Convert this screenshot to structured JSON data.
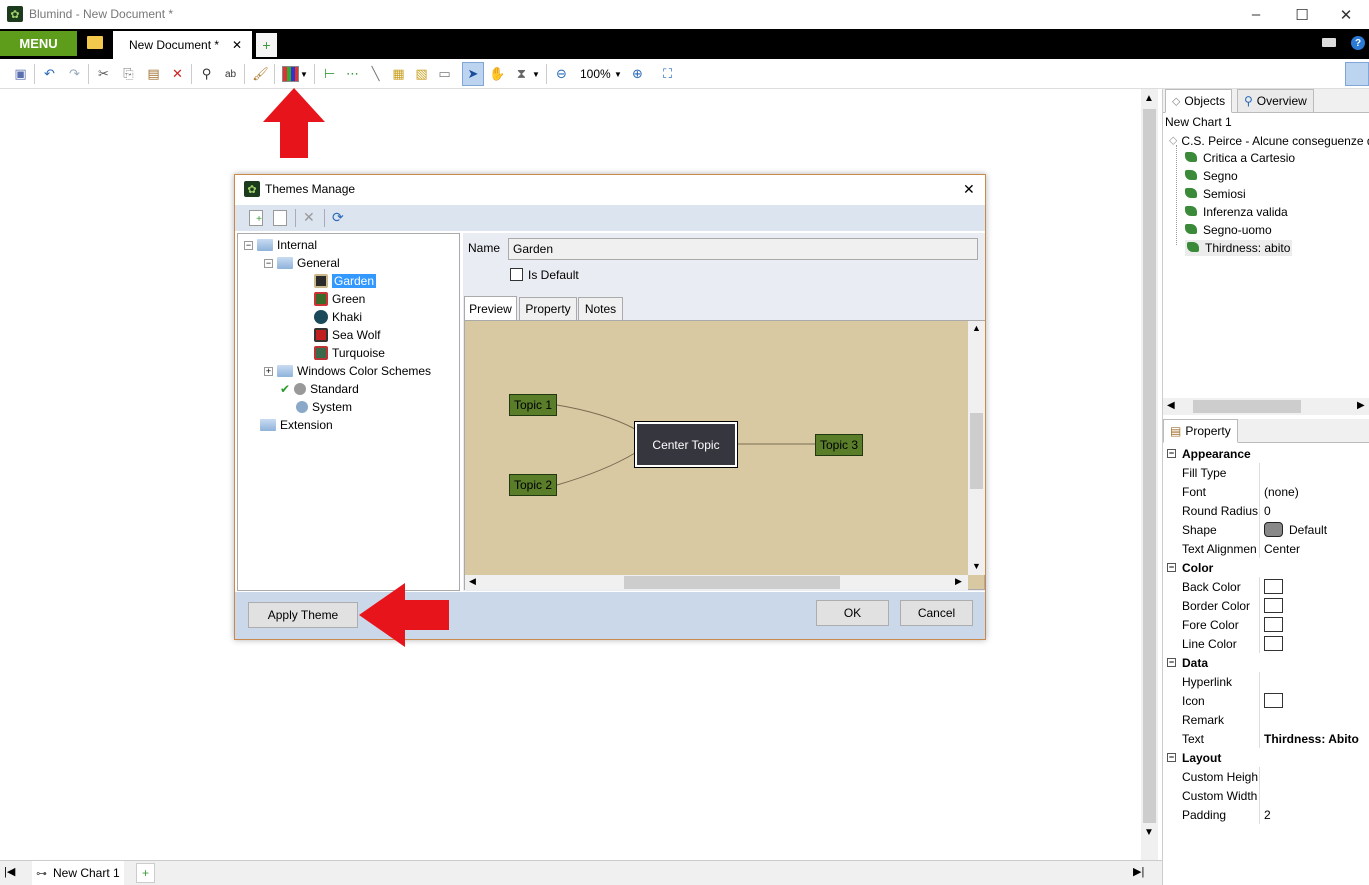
{
  "window": {
    "title": "Blumind - New Document *"
  },
  "tabbar": {
    "menu_label": "MENU",
    "doc_tab": "New Document *"
  },
  "toolbar": {
    "zoom": "100%"
  },
  "right_panel": {
    "tabs": [
      "Objects",
      "Overview"
    ],
    "chart_name": "New Chart 1",
    "root_topic": "C.S. Peirce - Alcune conseguenze d",
    "children": [
      "Critica a Cartesio",
      "Segno",
      "Semiosi",
      "Inferenza valida",
      "Segno-uomo",
      "Thirdness: abito"
    ],
    "property_tab": "Property",
    "sections": {
      "appearance": "Appearance",
      "color": "Color",
      "data": "Data",
      "layout": "Layout"
    },
    "props": {
      "fill_type": "Fill Type",
      "font": "Font",
      "font_val": "(none)",
      "round_radius": "Round Radius",
      "round_radius_val": "0",
      "shape": "Shape",
      "shape_val": "Default",
      "text_align": "Text Alignmen",
      "text_align_val": "Center",
      "back_color": "Back Color",
      "border_color": "Border Color",
      "fore_color": "Fore Color",
      "line_color": "Line Color",
      "hyperlink": "Hyperlink",
      "icon": "Icon",
      "remark": "Remark",
      "text": "Text",
      "text_val": "Thirdness: Abito",
      "custom_height": "Custom Heigh",
      "custom_width": "Custom Width",
      "padding": "Padding",
      "padding_val": "2"
    }
  },
  "bottom": {
    "chart_tab": "New Chart 1"
  },
  "dialog": {
    "title": "Themes Manage",
    "tree": {
      "internal": "Internal",
      "general": "General",
      "themes": [
        "Garden",
        "Green",
        "Khaki",
        "Sea Wolf",
        "Turquoise"
      ],
      "windows_schemes": "Windows Color Schemes",
      "standard": "Standard",
      "system": "System",
      "extension": "Extension"
    },
    "name_label": "Name",
    "name_value": "Garden",
    "is_default": "Is Default",
    "tabs": [
      "Preview",
      "Property",
      "Notes"
    ],
    "preview": {
      "center": "Center Topic",
      "topic1": "Topic 1",
      "topic2": "Topic 2",
      "topic3": "Topic 3"
    },
    "apply_button": "Apply Theme",
    "ok_button": "OK",
    "cancel_button": "Cancel"
  },
  "colors": {
    "accent_green": "#5d9d1b",
    "arrow_red": "#e8141c",
    "preview_bg": "#d8c9a3",
    "topic_green": "#5a7d2a"
  }
}
